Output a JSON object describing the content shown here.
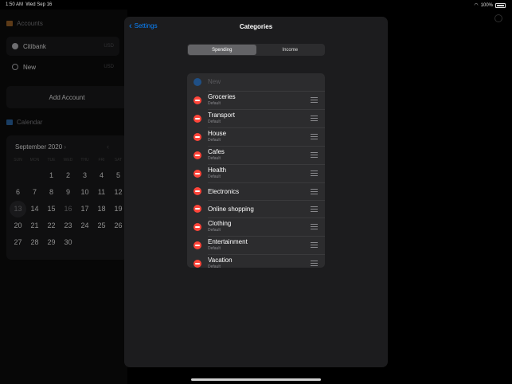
{
  "status": {
    "time": "1:50 AM",
    "date": "Wed Sep 16",
    "battery": "100%"
  },
  "sidebar": {
    "accounts_header": "Accounts",
    "accounts": [
      {
        "name": "Citibank",
        "currency": "USD",
        "selected": true
      },
      {
        "name": "New",
        "currency": "USD",
        "selected": false
      }
    ],
    "add_account_label": "Add Account",
    "calendar_header": "Calendar",
    "calendar": {
      "month": "September 2020",
      "weekdays": [
        "SUN",
        "MON",
        "TUE",
        "WED",
        "THU",
        "FRI",
        "SAT"
      ],
      "weeks": [
        [
          "",
          "",
          "1",
          "2",
          "3",
          "4",
          "5"
        ],
        [
          "6",
          "7",
          "8",
          "9",
          "10",
          "11",
          "12"
        ],
        [
          "13",
          "14",
          "15",
          "16",
          "17",
          "18",
          "19"
        ],
        [
          "20",
          "21",
          "22",
          "23",
          "24",
          "25",
          "26"
        ],
        [
          "27",
          "28",
          "29",
          "30",
          "",
          "",
          ""
        ]
      ],
      "today": "13",
      "muted": [
        "16"
      ]
    }
  },
  "modal": {
    "back_label": "Settings",
    "title": "Categories",
    "segments": [
      {
        "label": "Spending",
        "active": true
      },
      {
        "label": "Income",
        "active": false
      }
    ],
    "new_placeholder": "New",
    "categories": [
      {
        "name": "Groceries",
        "sub": "Default"
      },
      {
        "name": "Transport",
        "sub": "Default"
      },
      {
        "name": "House",
        "sub": "Default"
      },
      {
        "name": "Cafes",
        "sub": "Default"
      },
      {
        "name": "Health",
        "sub": "Default"
      },
      {
        "name": "Electronics",
        "sub": ""
      },
      {
        "name": "Online shopping",
        "sub": ""
      },
      {
        "name": "Clothing",
        "sub": "Default"
      },
      {
        "name": "Entertainment",
        "sub": "Default"
      },
      {
        "name": "Vacation",
        "sub": "Default"
      }
    ]
  },
  "colors": {
    "accent": "#0a84ff",
    "delete": "#ff453a",
    "modal_bg": "#1c1c1e",
    "row_bg": "#2c2c2e"
  }
}
